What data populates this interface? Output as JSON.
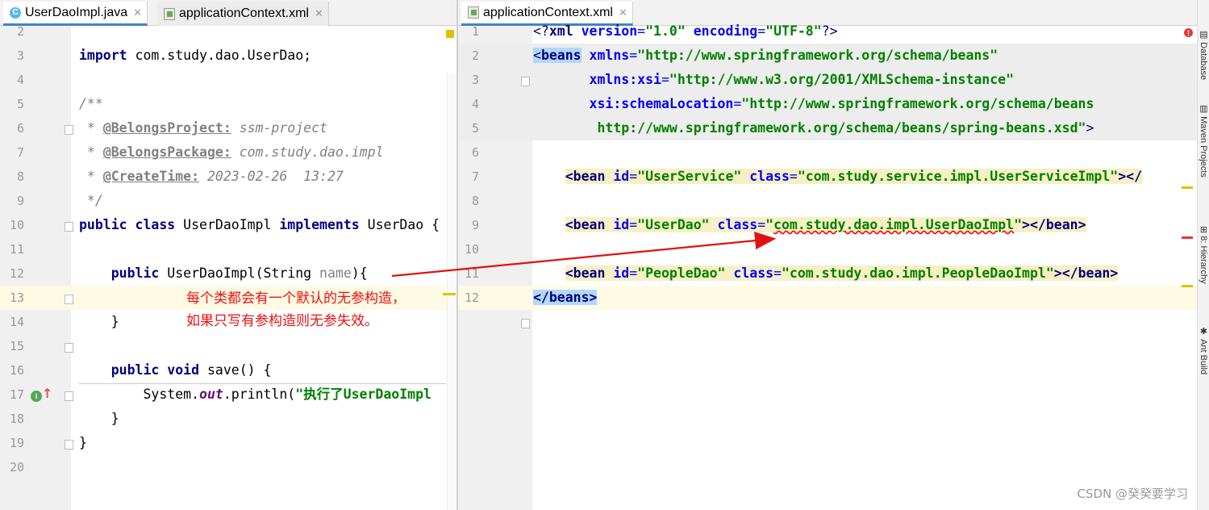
{
  "left_tabs": [
    {
      "label": "UserDaoImpl.java",
      "icon": "java-class-icon",
      "active": true
    },
    {
      "label": "applicationContext.xml",
      "icon": "xml-file-icon",
      "active": false
    }
  ],
  "right_tabs": [
    {
      "label": "applicationContext.xml",
      "icon": "xml-file-icon",
      "active": true
    }
  ],
  "left_lines": [
    {
      "num": "2"
    },
    {
      "num": "3",
      "code": [
        {
          "t": "import",
          "c": "kw"
        },
        {
          "t": " com.study.dao.UserDao;"
        }
      ]
    },
    {
      "num": "4"
    },
    {
      "num": "5",
      "code": [
        {
          "t": "/**",
          "c": "cm"
        }
      ]
    },
    {
      "num": "6",
      "code": [
        {
          "t": " * ",
          "c": "cm"
        },
        {
          "t": "@BelongsProject:",
          "c": "tag"
        },
        {
          "t": " ssm-project",
          "c": "cm"
        }
      ]
    },
    {
      "num": "7",
      "code": [
        {
          "t": " * ",
          "c": "cm"
        },
        {
          "t": "@BelongsPackage:",
          "c": "tag"
        },
        {
          "t": " com.study.dao.impl",
          "c": "cm"
        }
      ]
    },
    {
      "num": "8",
      "code": [
        {
          "t": " * ",
          "c": "cm"
        },
        {
          "t": "@CreateTime:",
          "c": "tag"
        },
        {
          "t": " 2023-02-26  13:27",
          "c": "cm"
        }
      ]
    },
    {
      "num": "9",
      "code": [
        {
          "t": " */",
          "c": "cm"
        }
      ]
    },
    {
      "num": "10",
      "code": [
        {
          "t": "public class",
          "c": "kw"
        },
        {
          "t": " UserDaoImpl "
        },
        {
          "t": "implements",
          "c": "kw"
        },
        {
          "t": " UserDao {"
        }
      ]
    },
    {
      "num": "11"
    },
    {
      "num": "12",
      "code": [
        {
          "t": "    "
        },
        {
          "t": "public",
          "c": "kw"
        },
        {
          "t": " UserDaoImpl(String "
        },
        {
          "t": "name",
          "c": "param"
        },
        {
          "t": "){"
        }
      ]
    },
    {
      "num": "13"
    },
    {
      "num": "14",
      "code": [
        {
          "t": "    }"
        }
      ]
    },
    {
      "num": "15"
    },
    {
      "num": "16",
      "code": [
        {
          "t": "    "
        },
        {
          "t": "public void",
          "c": "kw"
        },
        {
          "t": " save() {"
        }
      ]
    },
    {
      "num": "17",
      "code": [
        {
          "t": "        System."
        },
        {
          "t": "out",
          "c": "fld"
        },
        {
          "t": ".println("
        },
        {
          "t": "\"执行了UserDaoImpl",
          "c": "str"
        }
      ]
    },
    {
      "num": "18",
      "code": [
        {
          "t": "    }"
        }
      ]
    },
    {
      "num": "19",
      "code": [
        {
          "t": "}"
        }
      ]
    },
    {
      "num": "20"
    }
  ],
  "right_lines": [
    {
      "num": "1",
      "code": [
        {
          "t": "<?",
          "c": "xmltag"
        },
        {
          "t": "xml ",
          "c": "tagn"
        },
        {
          "t": "version",
          "c": "attr"
        },
        {
          "t": "=",
          "c": "xmlattr"
        },
        {
          "t": "\"1.0\"",
          "c": "xmlval"
        },
        {
          "t": " "
        },
        {
          "t": "encoding",
          "c": "attr"
        },
        {
          "t": "=",
          "c": "xmlattr"
        },
        {
          "t": "\"UTF-8\"",
          "c": "xmlval"
        },
        {
          "t": "?>",
          "c": "xmltag"
        }
      ]
    },
    {
      "num": "2",
      "code": [
        {
          "t": "<",
          "c": "xmltag sel-bg"
        },
        {
          "t": "beans",
          "c": "tagn sel-bg"
        },
        {
          "t": " "
        },
        {
          "t": "xmlns",
          "c": "attr"
        },
        {
          "t": "=",
          "c": "xmlattr"
        },
        {
          "t": "\"http://www.springframework.org/schema/beans\"",
          "c": "xmlval"
        }
      ]
    },
    {
      "num": "3",
      "code": [
        {
          "t": "       "
        },
        {
          "t": "xmlns:xsi",
          "c": "attr"
        },
        {
          "t": "=",
          "c": "xmlattr"
        },
        {
          "t": "\"http://www.w3.org/2001/XMLSchema-instance\"",
          "c": "xmlval"
        }
      ]
    },
    {
      "num": "4",
      "code": [
        {
          "t": "       "
        },
        {
          "t": "xsi:schemaLocation",
          "c": "attr"
        },
        {
          "t": "=",
          "c": "xmlattr"
        },
        {
          "t": "\"http://www.springframework.org/schema/beans",
          "c": "xmlval"
        }
      ]
    },
    {
      "num": "5",
      "code": [
        {
          "t": "        "
        },
        {
          "t": "http://www.springframework.org/schema/beans/spring-beans.xsd\"",
          "c": "xmlval"
        },
        {
          "t": ">",
          "c": "xmltag"
        }
      ]
    },
    {
      "num": "6"
    },
    {
      "num": "7",
      "code": [
        {
          "t": "    "
        },
        {
          "t": "<bean ",
          "c": "tagn bean-bg"
        },
        {
          "t": "id",
          "c": "attr bean-bg"
        },
        {
          "t": "=",
          "c": "xmlattr bean-bg"
        },
        {
          "t": "\"UserService\"",
          "c": "xmlval bean-bg"
        },
        {
          "t": " ",
          "c": "bean-bg"
        },
        {
          "t": "class",
          "c": "attr bean-bg"
        },
        {
          "t": "=",
          "c": "xmlattr bean-bg"
        },
        {
          "t": "\"com.study.service.impl.UserServiceImpl\"",
          "c": "xmlval bean-bg"
        },
        {
          "t": "></",
          "c": "tagn bean-bg"
        }
      ]
    },
    {
      "num": "8"
    },
    {
      "num": "9",
      "code": [
        {
          "t": "    "
        },
        {
          "t": "<bean ",
          "c": "tagn bean-bg"
        },
        {
          "t": "id",
          "c": "attr bean-bg"
        },
        {
          "t": "=",
          "c": "xmlattr bean-bg"
        },
        {
          "t": "\"UserDao\"",
          "c": "xmlval bean-bg"
        },
        {
          "t": " ",
          "c": "bean-bg"
        },
        {
          "t": "class",
          "c": "attr bean-bg"
        },
        {
          "t": "=",
          "c": "xmlattr bean-bg"
        },
        {
          "t": "\"",
          "c": "xmlval bean-bg"
        },
        {
          "t": "com.study.dao.impl.UserDaoImpl",
          "c": "xmlval bean-bg wavy"
        },
        {
          "t": "\"",
          "c": "xmlval bean-bg"
        },
        {
          "t": "></",
          "c": "tagn bean-bg"
        },
        {
          "t": "bean",
          "c": "tagn bean-bg"
        },
        {
          "t": ">",
          "c": "tagn bean-bg"
        }
      ]
    },
    {
      "num": "10"
    },
    {
      "num": "11",
      "code": [
        {
          "t": "    "
        },
        {
          "t": "<bean ",
          "c": "tagn bean-bg"
        },
        {
          "t": "id",
          "c": "attr bean-bg"
        },
        {
          "t": "=",
          "c": "xmlattr bean-bg"
        },
        {
          "t": "\"PeopleDao\"",
          "c": "xmlval bean-bg"
        },
        {
          "t": " ",
          "c": "bean-bg"
        },
        {
          "t": "class",
          "c": "attr bean-bg"
        },
        {
          "t": "=",
          "c": "xmlattr bean-bg"
        },
        {
          "t": "\"com.study.dao.impl.PeopleDaoImpl\"",
          "c": "xmlval bean-bg"
        },
        {
          "t": "></",
          "c": "tagn bean-bg"
        },
        {
          "t": "bean",
          "c": "tagn bean-bg"
        },
        {
          "t": ">",
          "c": "tagn bean-bg"
        }
      ]
    },
    {
      "num": "12",
      "code": [
        {
          "t": "</",
          "c": "tagn sel-bg"
        },
        {
          "t": "beans",
          "c": "tagn sel-bg"
        },
        {
          "t": ">",
          "c": "tagn sel-bg"
        }
      ]
    }
  ],
  "annotation": {
    "line1": "每个类都会有一个默认的无参构造，",
    "line2": "如果只写有参构造则无参失效。",
    "color": "#e11111"
  },
  "tool_windows": [
    "Database",
    "Maven Projects",
    "Hierarchy",
    "Ant Build"
  ],
  "tool_icons": [
    "database-icon",
    "maven-icon",
    "hierarchy-icon",
    "ant-icon"
  ],
  "watermark": "CSDN @癸癸要学习",
  "colors": {
    "keyword": "#000080",
    "string": "#008000",
    "comment": "#808080",
    "current_line": "#fffae3",
    "selection": "#b3d7ff",
    "bean_highlight": "#f6f0c4",
    "error_underline": "#ff0000"
  }
}
